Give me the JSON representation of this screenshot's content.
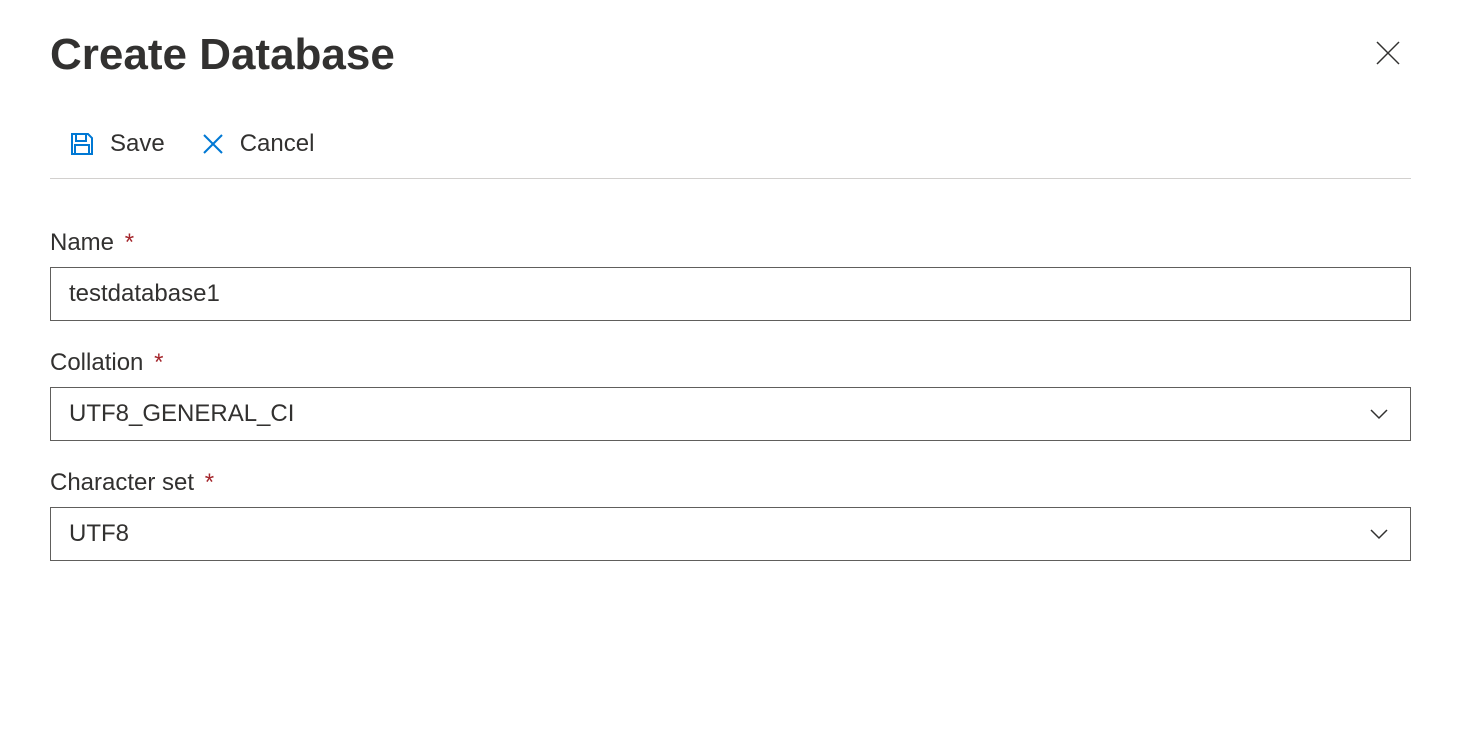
{
  "title": "Create Database",
  "toolbar": {
    "save_label": "Save",
    "cancel_label": "Cancel"
  },
  "form": {
    "name": {
      "label": "Name",
      "required": "*",
      "value": "testdatabase1"
    },
    "collation": {
      "label": "Collation",
      "required": "*",
      "value": "UTF8_GENERAL_CI"
    },
    "charset": {
      "label": "Character set",
      "required": "*",
      "value": "UTF8"
    }
  }
}
